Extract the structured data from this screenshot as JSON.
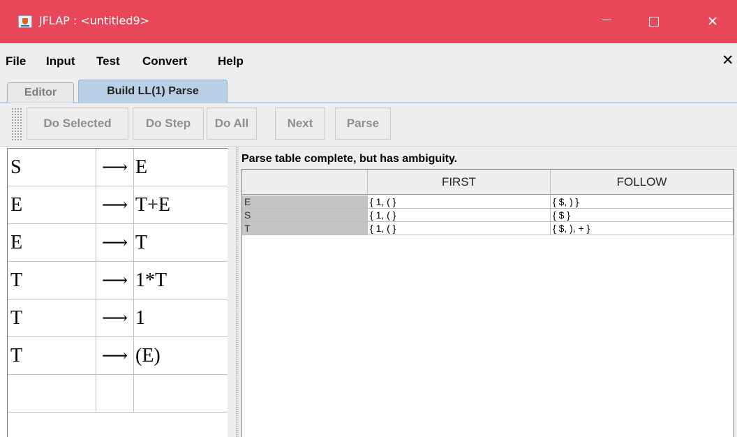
{
  "window": {
    "title": "JFLAP : <untitled9>"
  },
  "menu": {
    "items": [
      "File",
      "Input",
      "Test",
      "Convert",
      "Help"
    ],
    "close_label": "✕"
  },
  "tabs": [
    "Editor",
    "Build LL(1) Parse"
  ],
  "toolbar": {
    "buttons": [
      "Do Selected",
      "Do Step",
      "Do All",
      "Next",
      "Parse"
    ]
  },
  "grammar": {
    "arrow": "⟶",
    "productions": [
      {
        "lhs": "S",
        "rhs": "E"
      },
      {
        "lhs": "E",
        "rhs": "T+E"
      },
      {
        "lhs": "E",
        "rhs": "T"
      },
      {
        "lhs": "T",
        "rhs": "1*T"
      },
      {
        "lhs": "T",
        "rhs": "1"
      },
      {
        "lhs": "T",
        "rhs": "(E)"
      }
    ]
  },
  "parse": {
    "status": "Parse table complete, but has ambiguity.",
    "headers": [
      "",
      "FIRST",
      "FOLLOW"
    ],
    "rows": [
      {
        "nonterminal": "E",
        "first": "{ 1, ( }",
        "follow": "{ $, ) }"
      },
      {
        "nonterminal": "S",
        "first": "{ 1, ( }",
        "follow": "{ $ }"
      },
      {
        "nonterminal": "T",
        "first": "{ 1, ( }",
        "follow": "{ $, ), + }"
      }
    ]
  },
  "colors": {
    "titlebar": "#e8475a",
    "selected_tab": "#b8cfe5",
    "nonterminal_cell": "#c4c4c4"
  }
}
